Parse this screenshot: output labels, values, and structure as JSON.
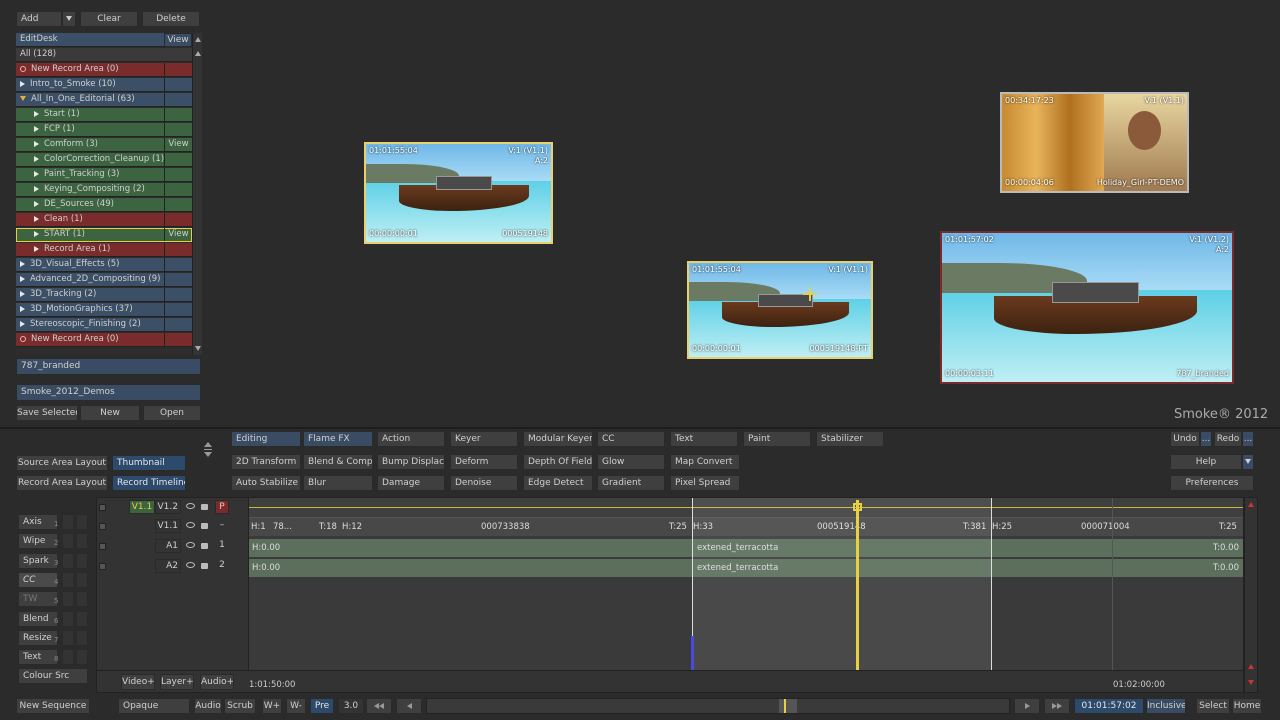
{
  "desk": {
    "add_label": "Add",
    "clear_label": "Clear",
    "delete_label": "Delete",
    "header": "EditDesk",
    "view_label": "View",
    "all_label": "All (128)",
    "items": [
      {
        "label": "New Record Area (0)",
        "kind": "circle",
        "color": "red",
        "indent": 0,
        "view": ""
      },
      {
        "label": "Intro_to_Smoke (10)",
        "kind": "arrow",
        "color": "blue",
        "indent": 0,
        "view": ""
      },
      {
        "label": "All_In_One_Editorial (63)",
        "kind": "open",
        "color": "blue",
        "indent": 0,
        "view": ""
      },
      {
        "label": "Start (1)",
        "kind": "arrow",
        "color": "green",
        "indent": 1,
        "view": ""
      },
      {
        "label": "FCP (1)",
        "kind": "arrow",
        "color": "green",
        "indent": 1,
        "view": ""
      },
      {
        "label": "Comform (3)",
        "kind": "arrow",
        "color": "green",
        "indent": 1,
        "view": "View"
      },
      {
        "label": "ColorCorrection_Cleanup (1)",
        "kind": "arrow",
        "color": "green",
        "indent": 1,
        "view": ""
      },
      {
        "label": "Paint_Tracking (3)",
        "kind": "arrow",
        "color": "green",
        "indent": 1,
        "view": ""
      },
      {
        "label": "Keying_Compositing (2)",
        "kind": "arrow",
        "color": "green",
        "indent": 1,
        "view": ""
      },
      {
        "label": "DE_Sources (49)",
        "kind": "arrow",
        "color": "green",
        "indent": 1,
        "view": ""
      },
      {
        "label": "Clean (1)",
        "kind": "arrow",
        "color": "red",
        "indent": 1,
        "view": ""
      },
      {
        "label": "START (1)",
        "kind": "arrow",
        "color": "green",
        "indent": 1,
        "view": "View",
        "selected": true
      },
      {
        "label": "Record Area (1)",
        "kind": "arrow",
        "color": "red",
        "indent": 1,
        "view": ""
      },
      {
        "label": "3D_Visual_Effects (5)",
        "kind": "arrow",
        "color": "blue",
        "indent": 0,
        "view": ""
      },
      {
        "label": "Advanced_2D_Compositing (9)",
        "kind": "arrow",
        "color": "blue",
        "indent": 0,
        "view": ""
      },
      {
        "label": "3D_Tracking (2)",
        "kind": "arrow",
        "color": "blue",
        "indent": 0,
        "view": ""
      },
      {
        "label": "3D_MotionGraphics (37)",
        "kind": "arrow",
        "color": "blue",
        "indent": 0,
        "view": ""
      },
      {
        "label": "Stereoscopic_Finishing (2)",
        "kind": "arrow",
        "color": "blue",
        "indent": 0,
        "view": ""
      },
      {
        "label": "New Record Area (0)",
        "kind": "circle",
        "color": "red",
        "indent": 0,
        "view": ""
      }
    ],
    "library_1": "787_branded",
    "library_2": "Smoke_2012_Demos",
    "save_selected_label": "Save Selected",
    "new_label": "New",
    "open_label": "Open"
  },
  "viewer": {
    "brand": "Smoke® 2012",
    "clips": [
      {
        "tc_top": "01:01:55:04",
        "track": "V:1 (V1.1)",
        "sub": "A:2",
        "tc_bottom": "00:00:00:01",
        "name": "000519148"
      },
      {
        "tc_top": "00:34:17:23",
        "track": "V:1 (V1.1)",
        "sub": "",
        "tc_bottom": "00:00:04:06",
        "name": "Holiday_Girl-PT-DEMO"
      },
      {
        "tc_top": "01:01:55:04",
        "track": "V:1 (V1.1)",
        "sub": "",
        "tc_bottom": "00:00:00:01",
        "name": "000519148-PT"
      },
      {
        "tc_top": "01:01:57:02",
        "track": "V:1 (V1.2)",
        "sub": "A:2",
        "tc_bottom": "00:00:03:11",
        "name": "787_branded"
      }
    ]
  },
  "fx_row1": [
    "Editing",
    "Flame FX",
    "Action",
    "Keyer",
    "Modular Keyer",
    "CC",
    "Text",
    "Paint",
    "Stabilizer"
  ],
  "fx_row2": [
    "2D Transform",
    "Blend & Comp",
    "Bump Displace",
    "Deform",
    "Depth Of Field",
    "Glow",
    "Map Convert"
  ],
  "fx_row3": [
    "Auto Stabilize",
    "Blur",
    "Damage",
    "Denoise",
    "Edge Detect",
    "Gradient",
    "Pixel Spread"
  ],
  "right_tools": {
    "undo": "Undo",
    "redo": "Redo",
    "help": "Help",
    "preferences": "Preferences",
    "more": "..."
  },
  "layout": {
    "source_area_layout": "Source Area Layout",
    "thumbnail": "Thumbnail",
    "record_area_layout": "Record Area Layout",
    "record_timeline": "Record Timeline"
  },
  "side_tools": [
    {
      "label": "Axis",
      "num": "1"
    },
    {
      "label": "Wipe",
      "num": "2"
    },
    {
      "label": "Spark",
      "num": "3"
    },
    {
      "label": "CC",
      "num": "4"
    },
    {
      "label": "TW",
      "num": "5"
    },
    {
      "label": "Blend",
      "num": "6"
    },
    {
      "label": "Resize",
      "num": "7"
    },
    {
      "label": "Text",
      "num": "8"
    },
    {
      "label": "Colour Src",
      "num": ""
    }
  ],
  "timeline": {
    "tracks": [
      {
        "name": "V1.1",
        "name2": "V1.2",
        "p": "P"
      },
      {
        "name": "",
        "name2": "V1.1",
        "p": "–"
      },
      {
        "name": "",
        "name2": "A1",
        "p": "1"
      },
      {
        "name": "",
        "name2": "A2",
        "p": "2"
      }
    ],
    "v_labels": [
      "H:1",
      "78...",
      "T:18",
      "H:12",
      "000733838",
      "T:25",
      "H:33",
      "000519148",
      "T:381",
      "H:25",
      "000071004",
      "T:25"
    ],
    "a1": {
      "head": "H:0.00",
      "clip": "extened_terracotta",
      "tail": "T:0.00"
    },
    "a2": {
      "head": "H:0.00",
      "clip": "extened_terracotta",
      "tail": "T:0.00"
    },
    "start_tc": "1:01:50:00",
    "end_tc": "01:02:00:00",
    "add_video": "Video+",
    "add_layer": "Layer+",
    "add_audio": "Audio+"
  },
  "bottom": {
    "new_sequence": "New Sequence",
    "opaque": "Opaque",
    "audio": "Audio",
    "scrub": "Scrub",
    "w_plus": "W+",
    "w_minus": "W-",
    "pre": "Pre",
    "speed": "3.0",
    "timecode": "01:01:57:02",
    "inclusive": "Inclusive",
    "select": "Select",
    "home": "Home"
  },
  "colors": {
    "accent": "#e8d040",
    "green_track": "#5b6f5c",
    "blue_btn": "#3a4c63",
    "red_row": "#7a2b2b",
    "green_row": "#3c6440"
  }
}
